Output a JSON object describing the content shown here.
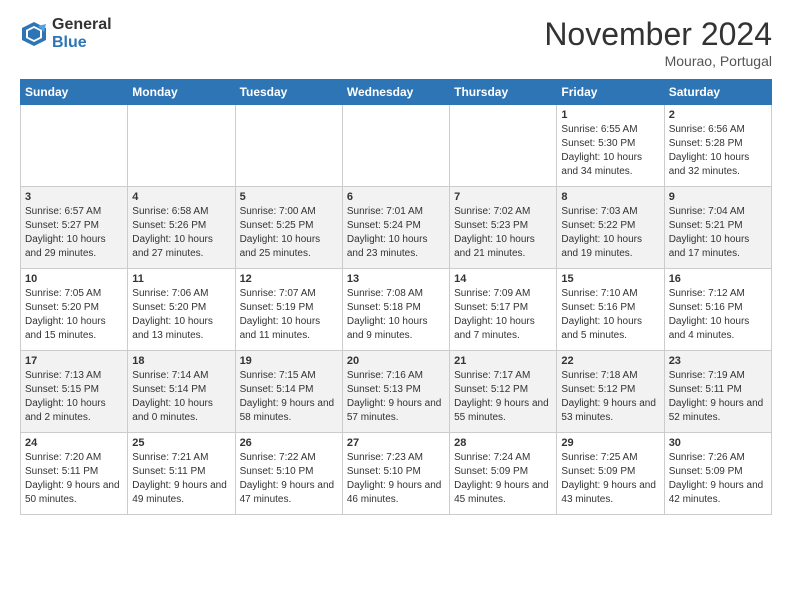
{
  "logo": {
    "general": "General",
    "blue": "Blue"
  },
  "title": "November 2024",
  "location": "Mourao, Portugal",
  "days_of_week": [
    "Sunday",
    "Monday",
    "Tuesday",
    "Wednesday",
    "Thursday",
    "Friday",
    "Saturday"
  ],
  "weeks": [
    {
      "days": [
        {
          "number": "",
          "info": ""
        },
        {
          "number": "",
          "info": ""
        },
        {
          "number": "",
          "info": ""
        },
        {
          "number": "",
          "info": ""
        },
        {
          "number": "",
          "info": ""
        },
        {
          "number": "1",
          "info": "Sunrise: 6:55 AM\nSunset: 5:30 PM\nDaylight: 10 hours and 34 minutes."
        },
        {
          "number": "2",
          "info": "Sunrise: 6:56 AM\nSunset: 5:28 PM\nDaylight: 10 hours and 32 minutes."
        }
      ]
    },
    {
      "days": [
        {
          "number": "3",
          "info": "Sunrise: 6:57 AM\nSunset: 5:27 PM\nDaylight: 10 hours and 29 minutes."
        },
        {
          "number": "4",
          "info": "Sunrise: 6:58 AM\nSunset: 5:26 PM\nDaylight: 10 hours and 27 minutes."
        },
        {
          "number": "5",
          "info": "Sunrise: 7:00 AM\nSunset: 5:25 PM\nDaylight: 10 hours and 25 minutes."
        },
        {
          "number": "6",
          "info": "Sunrise: 7:01 AM\nSunset: 5:24 PM\nDaylight: 10 hours and 23 minutes."
        },
        {
          "number": "7",
          "info": "Sunrise: 7:02 AM\nSunset: 5:23 PM\nDaylight: 10 hours and 21 minutes."
        },
        {
          "number": "8",
          "info": "Sunrise: 7:03 AM\nSunset: 5:22 PM\nDaylight: 10 hours and 19 minutes."
        },
        {
          "number": "9",
          "info": "Sunrise: 7:04 AM\nSunset: 5:21 PM\nDaylight: 10 hours and 17 minutes."
        }
      ]
    },
    {
      "days": [
        {
          "number": "10",
          "info": "Sunrise: 7:05 AM\nSunset: 5:20 PM\nDaylight: 10 hours and 15 minutes."
        },
        {
          "number": "11",
          "info": "Sunrise: 7:06 AM\nSunset: 5:20 PM\nDaylight: 10 hours and 13 minutes."
        },
        {
          "number": "12",
          "info": "Sunrise: 7:07 AM\nSunset: 5:19 PM\nDaylight: 10 hours and 11 minutes."
        },
        {
          "number": "13",
          "info": "Sunrise: 7:08 AM\nSunset: 5:18 PM\nDaylight: 10 hours and 9 minutes."
        },
        {
          "number": "14",
          "info": "Sunrise: 7:09 AM\nSunset: 5:17 PM\nDaylight: 10 hours and 7 minutes."
        },
        {
          "number": "15",
          "info": "Sunrise: 7:10 AM\nSunset: 5:16 PM\nDaylight: 10 hours and 5 minutes."
        },
        {
          "number": "16",
          "info": "Sunrise: 7:12 AM\nSunset: 5:16 PM\nDaylight: 10 hours and 4 minutes."
        }
      ]
    },
    {
      "days": [
        {
          "number": "17",
          "info": "Sunrise: 7:13 AM\nSunset: 5:15 PM\nDaylight: 10 hours and 2 minutes."
        },
        {
          "number": "18",
          "info": "Sunrise: 7:14 AM\nSunset: 5:14 PM\nDaylight: 10 hours and 0 minutes."
        },
        {
          "number": "19",
          "info": "Sunrise: 7:15 AM\nSunset: 5:14 PM\nDaylight: 9 hours and 58 minutes."
        },
        {
          "number": "20",
          "info": "Sunrise: 7:16 AM\nSunset: 5:13 PM\nDaylight: 9 hours and 57 minutes."
        },
        {
          "number": "21",
          "info": "Sunrise: 7:17 AM\nSunset: 5:12 PM\nDaylight: 9 hours and 55 minutes."
        },
        {
          "number": "22",
          "info": "Sunrise: 7:18 AM\nSunset: 5:12 PM\nDaylight: 9 hours and 53 minutes."
        },
        {
          "number": "23",
          "info": "Sunrise: 7:19 AM\nSunset: 5:11 PM\nDaylight: 9 hours and 52 minutes."
        }
      ]
    },
    {
      "days": [
        {
          "number": "24",
          "info": "Sunrise: 7:20 AM\nSunset: 5:11 PM\nDaylight: 9 hours and 50 minutes."
        },
        {
          "number": "25",
          "info": "Sunrise: 7:21 AM\nSunset: 5:11 PM\nDaylight: 9 hours and 49 minutes."
        },
        {
          "number": "26",
          "info": "Sunrise: 7:22 AM\nSunset: 5:10 PM\nDaylight: 9 hours and 47 minutes."
        },
        {
          "number": "27",
          "info": "Sunrise: 7:23 AM\nSunset: 5:10 PM\nDaylight: 9 hours and 46 minutes."
        },
        {
          "number": "28",
          "info": "Sunrise: 7:24 AM\nSunset: 5:09 PM\nDaylight: 9 hours and 45 minutes."
        },
        {
          "number": "29",
          "info": "Sunrise: 7:25 AM\nSunset: 5:09 PM\nDaylight: 9 hours and 43 minutes."
        },
        {
          "number": "30",
          "info": "Sunrise: 7:26 AM\nSunset: 5:09 PM\nDaylight: 9 hours and 42 minutes."
        }
      ]
    }
  ]
}
